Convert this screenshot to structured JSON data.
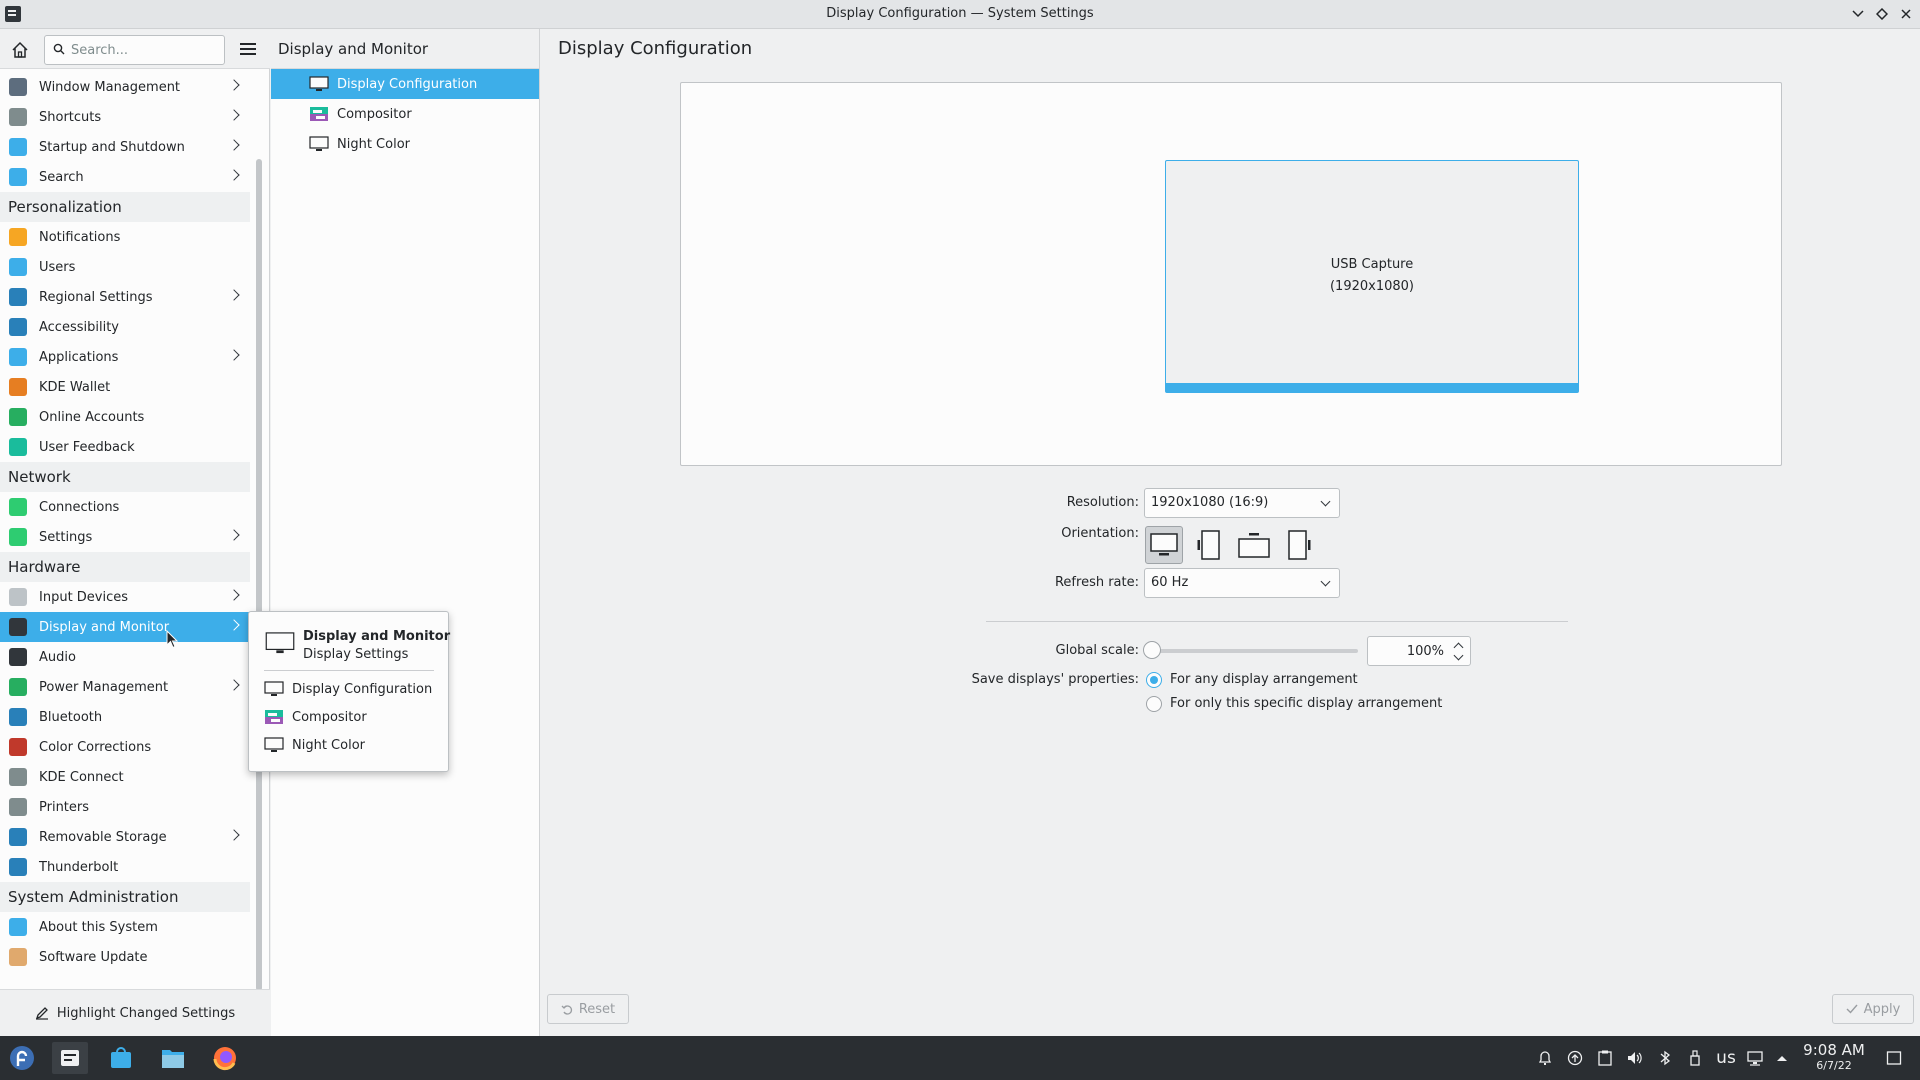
{
  "window": {
    "title": "Display Configuration — System Settings"
  },
  "sidebar": {
    "search_placeholder": "Search...",
    "items": [
      {
        "label": "Window Management",
        "icon": "window-management-icon",
        "color": "#5d6d7e",
        "chevron": true
      },
      {
        "label": "Shortcuts",
        "icon": "keyboard-icon",
        "color": "#7f8c8d",
        "chevron": true
      },
      {
        "label": "Startup and Shutdown",
        "icon": "startup-icon",
        "color": "#3daee9",
        "chevron": true
      },
      {
        "label": "Search",
        "icon": "search-icon",
        "color": "#3daee9",
        "chevron": true
      },
      {
        "label": "Personalization",
        "category": true
      },
      {
        "label": "Notifications",
        "icon": "bell-icon",
        "color": "#f6a623",
        "chevron": false
      },
      {
        "label": "Users",
        "icon": "users-icon",
        "color": "#3daee9",
        "chevron": false
      },
      {
        "label": "Regional Settings",
        "icon": "regional-icon",
        "color": "#2980b9",
        "chevron": true
      },
      {
        "label": "Accessibility",
        "icon": "accessibility-icon",
        "color": "#2980b9",
        "chevron": false
      },
      {
        "label": "Applications",
        "icon": "applications-icon",
        "color": "#3daee9",
        "chevron": true
      },
      {
        "label": "KDE Wallet",
        "icon": "wallet-icon",
        "color": "#e67e22",
        "chevron": false
      },
      {
        "label": "Online Accounts",
        "icon": "online-accounts-icon",
        "color": "#27ae60",
        "chevron": false
      },
      {
        "label": "User Feedback",
        "icon": "feedback-icon",
        "color": "#1abc9c",
        "chevron": false
      },
      {
        "label": "Network",
        "category": true
      },
      {
        "label": "Connections",
        "icon": "globe-icon",
        "color": "#2ecc71",
        "chevron": false
      },
      {
        "label": "Settings",
        "icon": "network-settings-icon",
        "color": "#2ecc71",
        "chevron": true
      },
      {
        "label": "Hardware",
        "category": true
      },
      {
        "label": "Input Devices",
        "icon": "mouse-icon",
        "color": "#bdc3c7",
        "chevron": true
      },
      {
        "label": "Display and Monitor",
        "icon": "monitor-icon",
        "color": "#31363b",
        "chevron": true,
        "selected": true
      },
      {
        "label": "Audio",
        "icon": "audio-icon",
        "color": "#31363b",
        "chevron": false
      },
      {
        "label": "Power Management",
        "icon": "power-icon",
        "color": "#27ae60",
        "chevron": true
      },
      {
        "label": "Bluetooth",
        "icon": "bluetooth-icon",
        "color": "#2980b9",
        "chevron": false
      },
      {
        "label": "Color Corrections",
        "icon": "color-icon",
        "color": "#c0392b",
        "chevron": false
      },
      {
        "label": "KDE Connect",
        "icon": "phone-icon",
        "color": "#7f8c8d",
        "chevron": false
      },
      {
        "label": "Printers",
        "icon": "printer-icon",
        "color": "#7f8c8d",
        "chevron": false
      },
      {
        "label": "Removable Storage",
        "icon": "usb-icon",
        "color": "#2980b9",
        "chevron": true
      },
      {
        "label": "Thunderbolt",
        "icon": "thunderbolt-icon",
        "color": "#2980b9",
        "chevron": false
      },
      {
        "label": "System Administration",
        "category": true
      },
      {
        "label": "About this System",
        "icon": "info-icon",
        "color": "#3daee9",
        "chevron": false
      },
      {
        "label": "Software Update",
        "icon": "update-icon",
        "color": "#e0a96d",
        "chevron": false
      }
    ],
    "highlight_label": "Highlight Changed Settings"
  },
  "subpanel": {
    "title": "Display and Monitor",
    "items": [
      {
        "label": "Display Configuration",
        "selected": true
      },
      {
        "label": "Compositor"
      },
      {
        "label": "Night Color"
      }
    ]
  },
  "main": {
    "title": "Display Configuration",
    "monitor": {
      "name": "USB Capture",
      "resolution": "(1920x1080)"
    },
    "resolution_label": "Resolution:",
    "resolution_value": "1920x1080 (16:9)",
    "orientation_label": "Orientation:",
    "refresh_label": "Refresh rate:",
    "refresh_value": "60 Hz",
    "scale_label": "Global scale:",
    "scale_value": "100%",
    "scale_level": 0,
    "save_label": "Save displays' properties:",
    "save_options": [
      "For any display arrangement",
      "For only this specific display arrangement"
    ],
    "reset_label": "Reset",
    "apply_label": "Apply"
  },
  "popup": {
    "title": "Display and Monitor",
    "subtitle": "Display Settings",
    "items": [
      "Display Configuration",
      "Compositor",
      "Night Color"
    ]
  },
  "taskbar": {
    "keyboard_layout": "us",
    "time": "9:08 AM",
    "date": "6/7/22"
  },
  "colors": {
    "accent": "#3daee9",
    "panel": "#2a2e32",
    "window": "#eff0f1"
  }
}
